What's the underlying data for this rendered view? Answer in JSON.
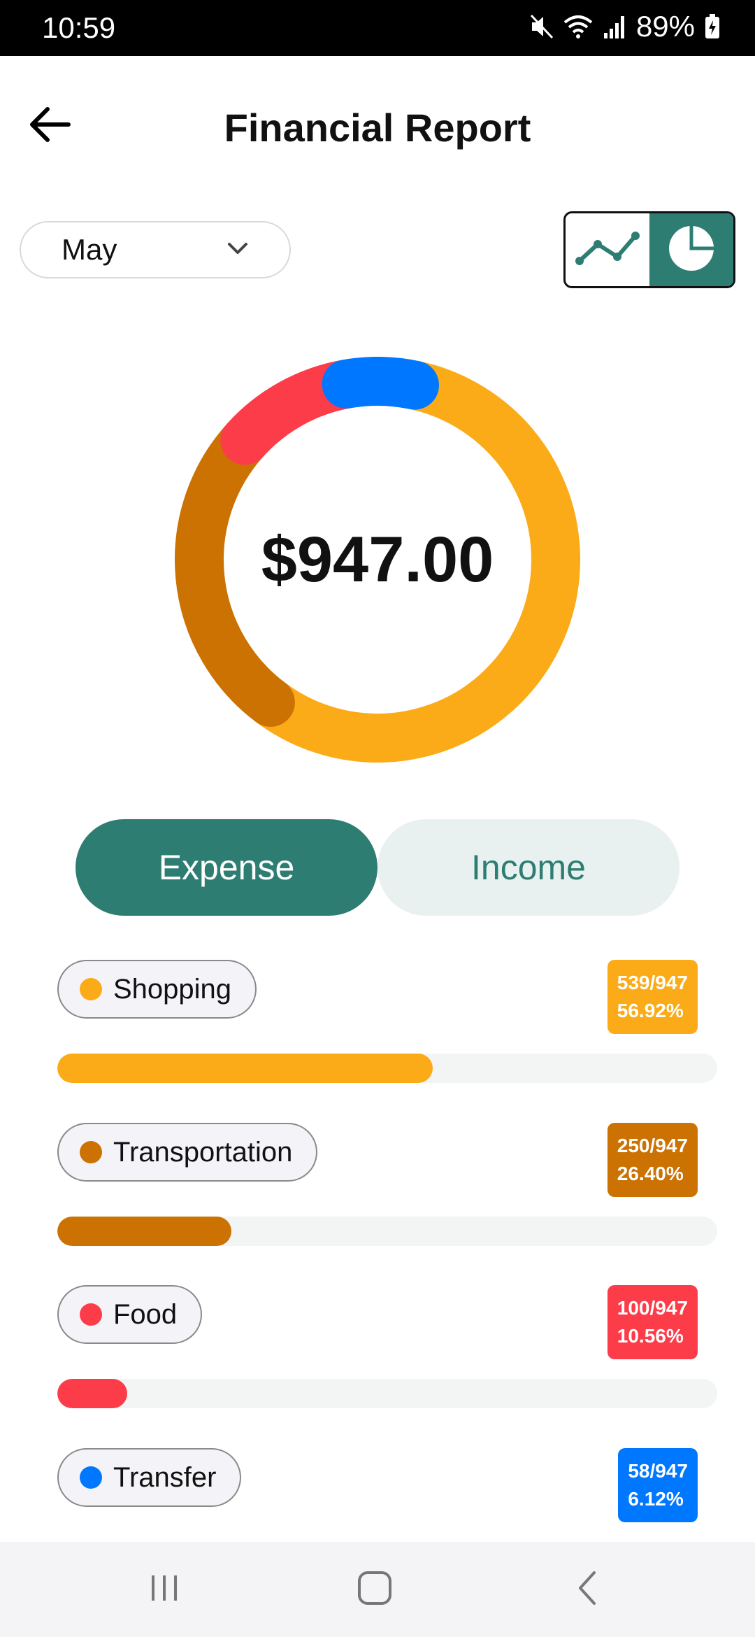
{
  "status_bar": {
    "time": "10:59",
    "battery": "89%",
    "icons": [
      "mute-icon",
      "wifi-icon",
      "signal-icon",
      "battery-charging-icon"
    ]
  },
  "header": {
    "title": "Financial Report",
    "back_icon": "arrow-left-icon"
  },
  "filter": {
    "month": "May",
    "chevron_icon": "chevron-down-icon"
  },
  "chart_toggle": {
    "options": [
      "line-chart-icon",
      "pie-chart-icon"
    ],
    "selected": "pie-chart-icon"
  },
  "chart_data": {
    "type": "pie",
    "title": "",
    "center_label": "$947.00",
    "categories": [
      "Shopping",
      "Transportation",
      "Food",
      "Transfer"
    ],
    "values": [
      539,
      250,
      100,
      58
    ],
    "colors": [
      "#fbab18",
      "#cb7202",
      "#fd3c4a",
      "#0077ff"
    ]
  },
  "tabs": [
    {
      "label": "Expense",
      "active": true
    },
    {
      "label": "Income",
      "active": false
    }
  ],
  "categories": [
    {
      "name": "Shopping",
      "ratio": "539/947",
      "percent": "56.92%",
      "fraction": 0.5692,
      "color": "#fbab18"
    },
    {
      "name": "Transportation",
      "ratio": "250/947",
      "percent": "26.40%",
      "fraction": 0.264,
      "color": "#cb7202"
    },
    {
      "name": "Food",
      "ratio": "100/947",
      "percent": "10.56%",
      "fraction": 0.1056,
      "color": "#fd3c4a"
    },
    {
      "name": "Transfer",
      "ratio": "58/947",
      "percent": "6.12%",
      "fraction": 0.0612,
      "color": "#0077ff"
    }
  ],
  "nav_bar": {
    "buttons": [
      "recent-apps-icon",
      "home-icon",
      "back-icon"
    ]
  },
  "colors": {
    "accent": "#2e7d73",
    "accent_light": "#e9f1f0"
  }
}
